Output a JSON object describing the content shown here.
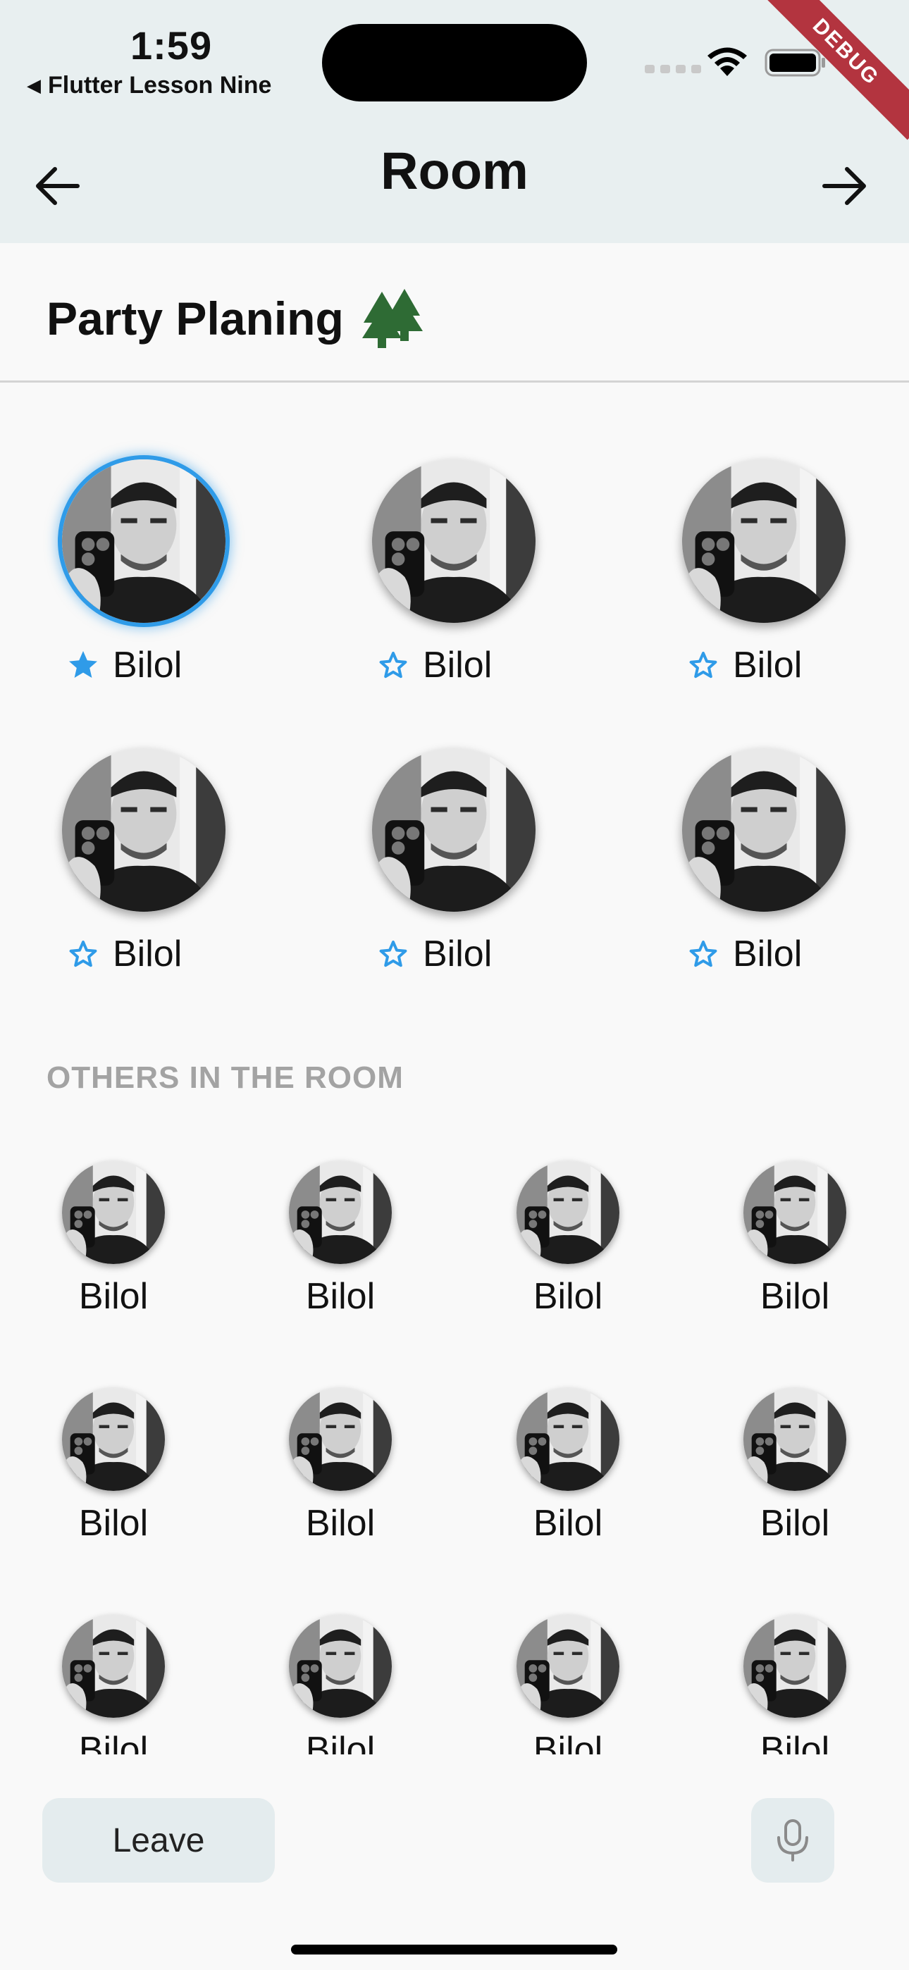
{
  "status_bar": {
    "time": "1:59",
    "back_app": "Flutter Lesson Nine",
    "debug_label": "DEBUG"
  },
  "app_bar": {
    "title": "Room",
    "left_icon": "arrow-left-icon",
    "right_icon": "arrow-right-icon"
  },
  "room": {
    "title": "Party Planing",
    "title_icon": "tree-icon"
  },
  "speakers": [
    {
      "name": "Bilol",
      "starred": true,
      "speaking": true
    },
    {
      "name": "Bilol",
      "starred": false,
      "speaking": false
    },
    {
      "name": "Bilol",
      "starred": false,
      "speaking": false
    },
    {
      "name": "Bilol",
      "starred": false,
      "speaking": false
    },
    {
      "name": "Bilol",
      "starred": false,
      "speaking": false
    },
    {
      "name": "Bilol",
      "starred": false,
      "speaking": false
    }
  ],
  "others_header": "OTHERS IN THE ROOM",
  "others": [
    "Bilol",
    "Bilol",
    "Bilol",
    "Bilol",
    "Bilol",
    "Bilol",
    "Bilol",
    "Bilol",
    "Bilol",
    "Bilol",
    "Bilol",
    "Bilol"
  ],
  "bottom": {
    "leave_label": "Leave",
    "mic_icon": "microphone-icon"
  },
  "colors": {
    "appbar_bg": "#e8eff0",
    "accent_blue": "#2f9be8",
    "tree_green": "#2e6b34",
    "debug_red": "#b3343f"
  }
}
